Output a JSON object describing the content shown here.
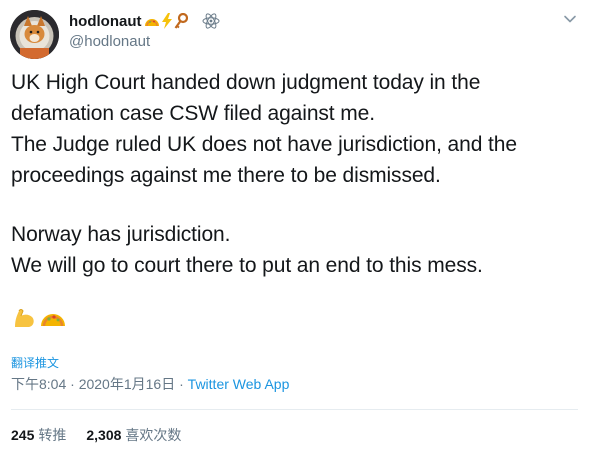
{
  "author": {
    "display_name": "hodlonaut",
    "handle": "@hodlonaut",
    "name_emojis": [
      "taco-icon",
      "lightning-icon",
      "key-icon"
    ],
    "badge_icon": "atom-icon"
  },
  "tweet": {
    "lines": [
      "UK High Court handed down judgment today in the",
      "defamation case CSW filed against me.",
      "The Judge ruled UK does not have jurisdiction, and the",
      "proceedings against me there to be dismissed.",
      "",
      "Norway has jurisdiction.",
      "We will go to court there to put an end to this mess."
    ],
    "trailing_emojis": [
      "flexed-biceps-icon",
      "taco-icon"
    ]
  },
  "translate_label": "翻译推文",
  "meta": {
    "time": "下午8:04",
    "separator": " · ",
    "date": "2020年1月16日",
    "separator2": " · ",
    "source": "Twitter Web App"
  },
  "stats": {
    "retweets_count": "245",
    "retweets_label": "转推",
    "likes_count": "2,308",
    "likes_label": "喜欢次数"
  },
  "colors": {
    "link": "#1b95e0",
    "secondary_text": "#657786",
    "primary_text": "#14171a",
    "divider": "#e6ecf0"
  }
}
